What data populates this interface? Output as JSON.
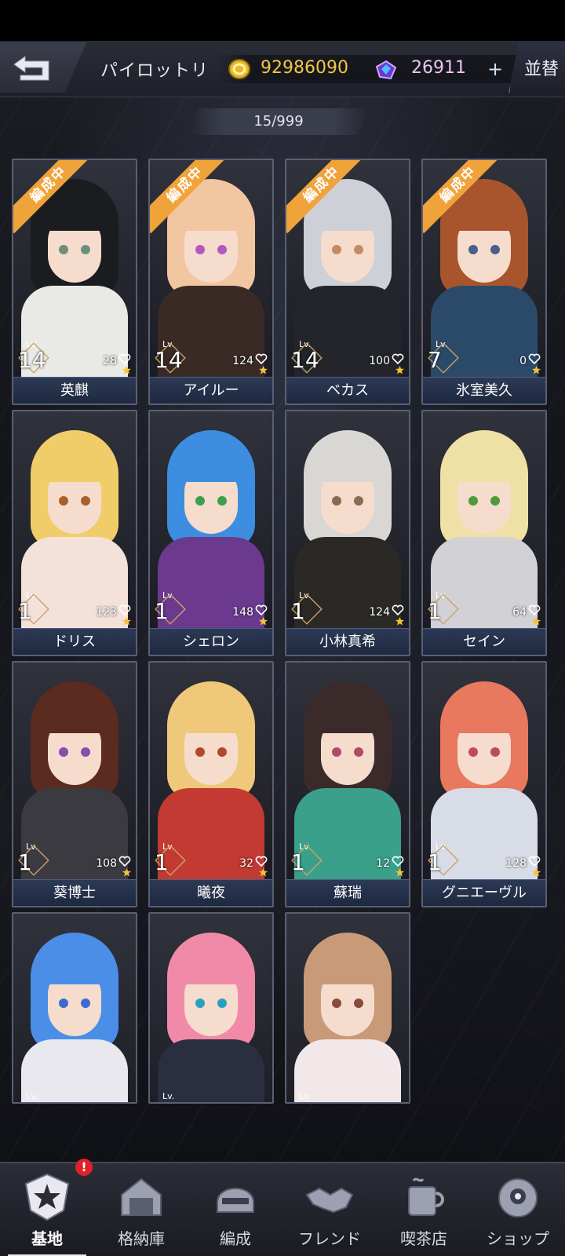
{
  "header": {
    "title": "パイロットリ",
    "coins": "92986090",
    "gems": "26911",
    "plus_label": "+",
    "sort_label": "並替",
    "count": "15/999"
  },
  "cards": [
    {
      "name": "英麒",
      "lv_label": "Lv.",
      "level": "14",
      "affinity": "28",
      "badge": "編成中",
      "hair": "#1a1c1f",
      "outfit": "#e9e9e6",
      "eye": "#6c8f7c"
    },
    {
      "name": "アイルー",
      "lv_label": "Lv.",
      "level": "14",
      "affinity": "124",
      "badge": "編成中",
      "hair": "#f2c6a0",
      "outfit": "#3a2a26",
      "eye": "#b05ac0"
    },
    {
      "name": "ベカス",
      "lv_label": "Lv.",
      "level": "14",
      "affinity": "100",
      "badge": "編成中",
      "hair": "#cdd0d6",
      "outfit": "#23252a",
      "eye": "#c48a66"
    },
    {
      "name": "氷室美久",
      "lv_label": "Lv.",
      "level": "7",
      "affinity": "0",
      "badge": "編成中",
      "hair": "#a8542d",
      "outfit": "#2b4a6a",
      "eye": "#4a5f8a"
    },
    {
      "name": "ドリス",
      "lv_label": "Lv.",
      "level": "1",
      "affinity": "123",
      "badge": "",
      "hair": "#f1cd6a",
      "outfit": "#f4e2da",
      "eye": "#a8602a"
    },
    {
      "name": "シェロン",
      "lv_label": "Lv.",
      "level": "1",
      "affinity": "148",
      "badge": "",
      "hair": "#3d8ee0",
      "outfit": "#6b3a8e",
      "eye": "#3aa04a"
    },
    {
      "name": "小林真希",
      "lv_label": "Lv.",
      "level": "1",
      "affinity": "124",
      "badge": "",
      "hair": "#d9d7d3",
      "outfit": "#2b2925",
      "eye": "#8a6a52"
    },
    {
      "name": "セイン",
      "lv_label": "Lv.",
      "level": "1",
      "affinity": "64",
      "badge": "",
      "hair": "#efe0a6",
      "outfit": "#d2d2d6",
      "eye": "#4f9a3a"
    },
    {
      "name": "葵博士",
      "lv_label": "Lv.",
      "level": "1",
      "affinity": "108",
      "badge": "",
      "hair": "#5a2b1e",
      "outfit": "#3a3a40",
      "eye": "#8a4ab0"
    },
    {
      "name": "曦夜",
      "lv_label": "Lv.",
      "level": "1",
      "affinity": "32",
      "badge": "",
      "hair": "#f0c87a",
      "outfit": "#c23a32",
      "eye": "#b04a2a"
    },
    {
      "name": "蘇瑞",
      "lv_label": "Lv.",
      "level": "1",
      "affinity": "12",
      "badge": "",
      "hair": "#3a2a2a",
      "outfit": "#3aa08a",
      "eye": "#b04a6a"
    },
    {
      "name": "グニエーヴル",
      "lv_label": "Lv.",
      "level": "1",
      "affinity": "128",
      "badge": "",
      "hair": "#e8785e",
      "outfit": "#d8dce6",
      "eye": "#c04a5a"
    },
    {
      "name": "",
      "lv_label": "Lv.",
      "level": "",
      "affinity": "",
      "badge": "",
      "hair": "#4a8ee8",
      "outfit": "#e8e8ee",
      "eye": "#3a6ad0"
    },
    {
      "name": "",
      "lv_label": "Lv.",
      "level": "",
      "affinity": "",
      "badge": "",
      "hair": "#f08aa8",
      "outfit": "#2b2e40",
      "eye": "#2aa0c0"
    },
    {
      "name": "",
      "lv_label": "Lv.",
      "level": "",
      "affinity": "",
      "badge": "",
      "hair": "#c99a78",
      "outfit": "#f2e8ea",
      "eye": "#8a4a3a"
    }
  ],
  "nav": {
    "alert": "!",
    "items": [
      {
        "label": "基地",
        "icon": "base-emblem-icon"
      },
      {
        "label": "格納庫",
        "icon": "hangar-icon"
      },
      {
        "label": "編成",
        "icon": "helmet-icon"
      },
      {
        "label": "フレンド",
        "icon": "handshake-icon"
      },
      {
        "label": "喫茶店",
        "icon": "cafe-icon"
      },
      {
        "label": "ショップ",
        "icon": "shop-robot-icon"
      }
    ]
  },
  "colors": {
    "coin": "#f1c646",
    "gem": "#e9c6ef",
    "badge": "#f0a33a",
    "nameplate": "#2d3a55"
  }
}
